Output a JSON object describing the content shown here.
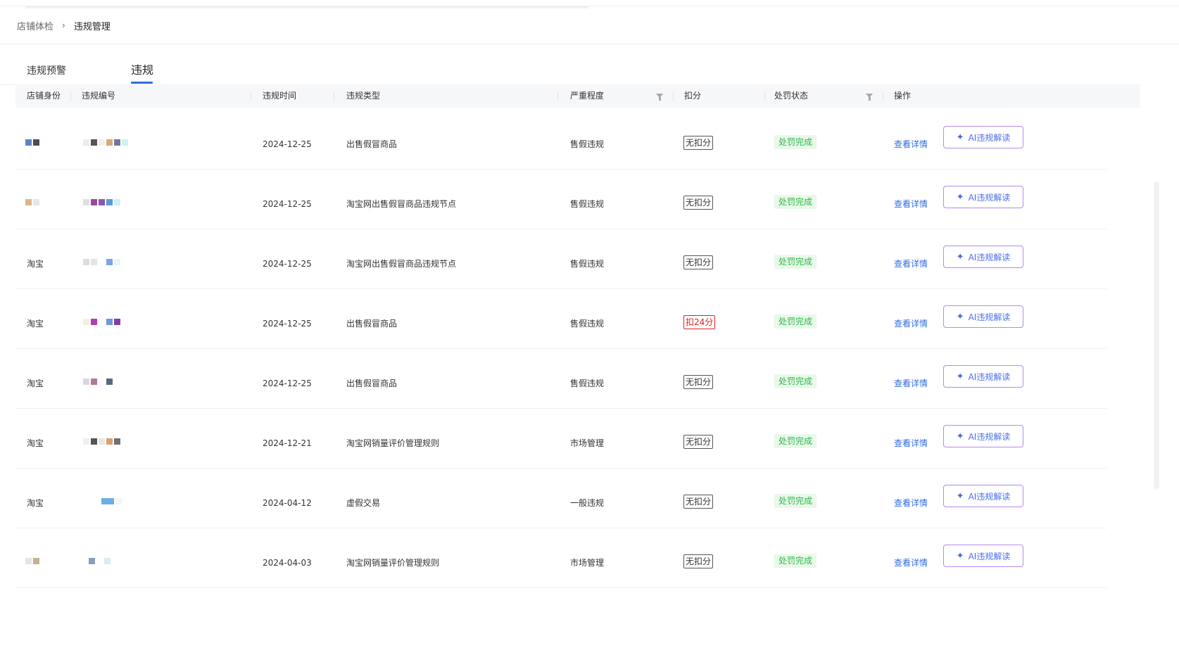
{
  "breadcrumb": {
    "items": [
      "店铺体检",
      "违规管理"
    ],
    "separator": "›"
  },
  "tabs": [
    {
      "label": "违规预警",
      "active": false
    },
    {
      "label": "违规",
      "active": true
    }
  ],
  "table": {
    "columns": [
      "店铺身份",
      "违规编号",
      "违规时间",
      "违规类型",
      "严重程度",
      "扣分",
      "处罚状态",
      "操作"
    ],
    "action_labels": {
      "detail": "查看详情",
      "ai": "AI违规解读"
    },
    "rows": [
      {
        "identity": "",
        "id": "",
        "time": "2024-12-25",
        "type": "出售假冒商品",
        "severity": "售假违规",
        "score": "无扣分",
        "status": "处罚完成"
      },
      {
        "identity": "",
        "id": "",
        "time": "2024-12-25",
        "type": "淘宝网出售假冒商品违规节点",
        "severity": "售假违规",
        "score": "无扣分",
        "status": "处罚完成"
      },
      {
        "identity": "淘宝",
        "id": "",
        "time": "2024-12-25",
        "type": "淘宝网出售假冒商品违规节点",
        "severity": "售假违规",
        "score": "无扣分",
        "status": "处罚完成"
      },
      {
        "identity": "淘宝",
        "id": "",
        "time": "2024-12-25",
        "type": "出售假冒商品",
        "severity": "售假违规",
        "score": "扣24分",
        "status": "处罚完成"
      },
      {
        "identity": "淘宝",
        "id": "",
        "time": "2024-12-25",
        "type": "出售假冒商品",
        "severity": "售假违规",
        "score": "无扣分",
        "status": "处罚完成"
      },
      {
        "identity": "淘宝",
        "id": "",
        "time": "2024-12-21",
        "type": "淘宝网销量评价管理规则",
        "severity": "市场管理",
        "score": "无扣分",
        "status": "处罚完成"
      },
      {
        "identity": "淘宝",
        "id": "",
        "time": "2024-04-12",
        "type": "虚假交易",
        "severity": "一般违规",
        "score": "无扣分",
        "status": "处罚完成"
      },
      {
        "identity": "",
        "id": "",
        "time": "2024-04-03",
        "type": "淘宝网销量评价管理规则",
        "severity": "市场管理",
        "score": "无扣分",
        "status": "处罚完成"
      }
    ]
  },
  "colors": {
    "link": "#2e6be6",
    "status_text": "#2fb94a",
    "status_bg": "#e9f8ea",
    "penalty_red": "#e02020",
    "ai_border": "#b48af0"
  },
  "icons": {
    "ai_button": "sparkle-icon",
    "filter": "filter-icon",
    "breadcrumb_separator": "chevron-right-icon"
  }
}
